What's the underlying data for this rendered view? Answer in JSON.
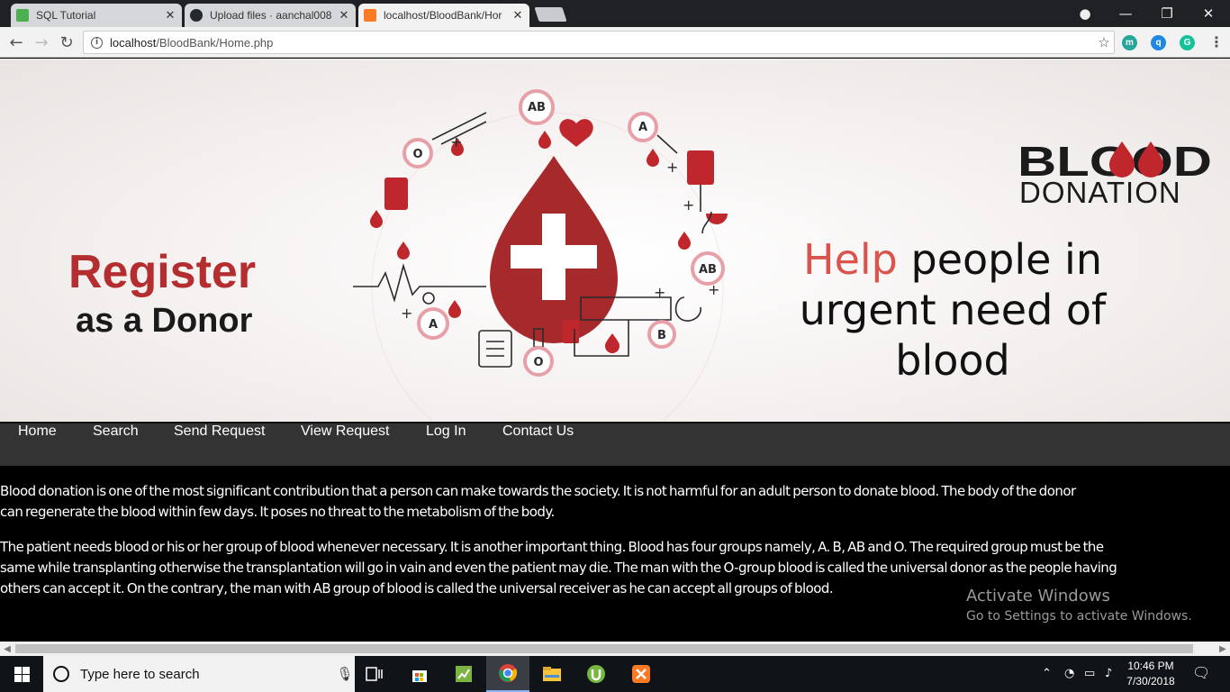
{
  "browser": {
    "tabs": [
      {
        "title": "SQL Tutorial",
        "favicon": "w3schools-icon",
        "active": false
      },
      {
        "title": "Upload files · aanchal008",
        "favicon": "github-icon",
        "active": false
      },
      {
        "title": "localhost/BloodBank/Hor",
        "favicon": "xampp-icon",
        "active": true
      }
    ],
    "url_host": "localhost",
    "url_path": "/BloodBank/Home.php",
    "extensions": [
      "m",
      "q",
      "G"
    ]
  },
  "banner": {
    "register_line1": "Register",
    "register_line2": "as a Donor",
    "help_accent": "Help",
    "help_line1_rest": "people in",
    "help_line2": "urgent need of",
    "help_line3": "blood",
    "logo_top": "BLOOD",
    "logo_bottom": "DONATION",
    "blood_group_labels": [
      "AB",
      "A",
      "O",
      "AB",
      "A",
      "B",
      "O"
    ],
    "colors": {
      "red": "#b42d2f",
      "accent": "#d9544d",
      "dark": "#1a1a1a"
    }
  },
  "nav": {
    "items": [
      "Home",
      "Search",
      "Send Request",
      "View Request",
      "Log In",
      "Contact Us"
    ],
    "background": "#333333"
  },
  "content": {
    "paragraph1_line1": "Blood donation is one of the most significant contribution that a person can make towards the society. It is not harmful for an adult person to donate blood. The body of the donor",
    "paragraph1_line2": "can regenerate the blood within few days. It poses no threat to the metabolism of the body.",
    "paragraph2_line1": "The patient needs blood or his or her group of blood whenever necessary. It is another important thing. Blood has four groups namely, A. B, AB and O. The required group must be the",
    "paragraph2_line2": "same while transplanting otherwise the transplantation will go in vain and even the patient may die. The man with the O-group blood is called the universal donor as the people having",
    "paragraph2_line3": "others can accept it. On the contrary, the man with AB group of blood is called the universal receiver as he can accept all groups of blood."
  },
  "watermark": {
    "title": "Activate Windows",
    "subtitle": "Go to Settings to activate Windows."
  },
  "taskbar": {
    "search_placeholder": "Type here to search",
    "time": "10:46 PM",
    "date": "7/30/2018",
    "pinned": [
      "task-view-icon",
      "store-icon",
      "sheet-app-icon",
      "chrome-icon",
      "file-explorer-icon",
      "utorrent-icon",
      "xampp-icon"
    ]
  }
}
